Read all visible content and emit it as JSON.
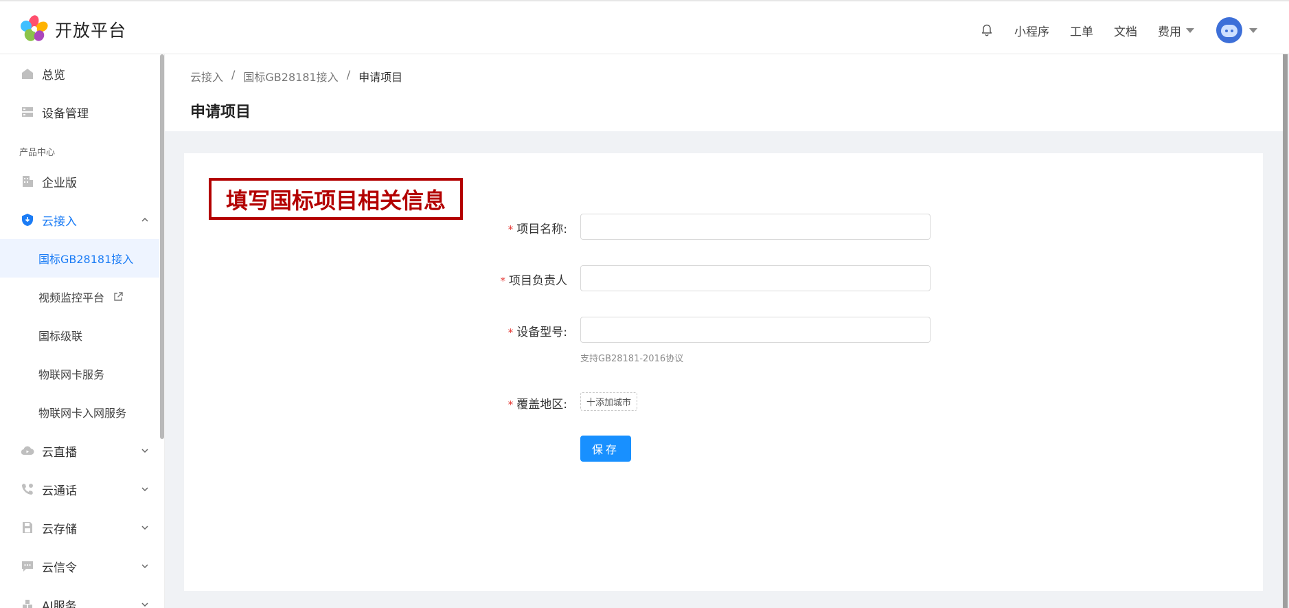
{
  "brand": {
    "name": "开放平台"
  },
  "topnav": {
    "items": [
      "小程序",
      "工单",
      "文档"
    ],
    "fee_label": "费用"
  },
  "sidebar": {
    "overview": "总览",
    "device_mgmt": "设备管理",
    "group_title": "产品中心",
    "enterprise": "企业版",
    "cloud_access": "云接入",
    "sub_items": [
      "国标GB28181接入",
      "视频监控平台",
      "国标级联",
      "物联网卡服务",
      "物联网卡入网服务"
    ],
    "cloud_live": "云直播",
    "cloud_call": "云通话",
    "cloud_storage": "云存储",
    "cloud_signal": "云信令",
    "ai_service": "AI服务"
  },
  "breadcrumb": {
    "items": [
      "云接入",
      "国标GB28181接入"
    ],
    "separator": "/",
    "current": "申请项目"
  },
  "page": {
    "title": "申请项目"
  },
  "annotation": {
    "text": "填写国标项目相关信息"
  },
  "form": {
    "required_mark": "*",
    "project_name_label": "项目名称:",
    "project_name_value": "",
    "owner_label": "项目负责人",
    "owner_value": "",
    "device_model_label": "设备型号:",
    "device_model_value": "",
    "device_model_hint": "支持GB28181-2016协议",
    "coverage_label": "覆盖地区:",
    "add_city_label": "十添加城市",
    "save_label": "保存"
  },
  "colors": {
    "primary": "#1890ff",
    "active_text": "#1b7cf5",
    "annotation": "#b30000",
    "required": "#e53935"
  }
}
